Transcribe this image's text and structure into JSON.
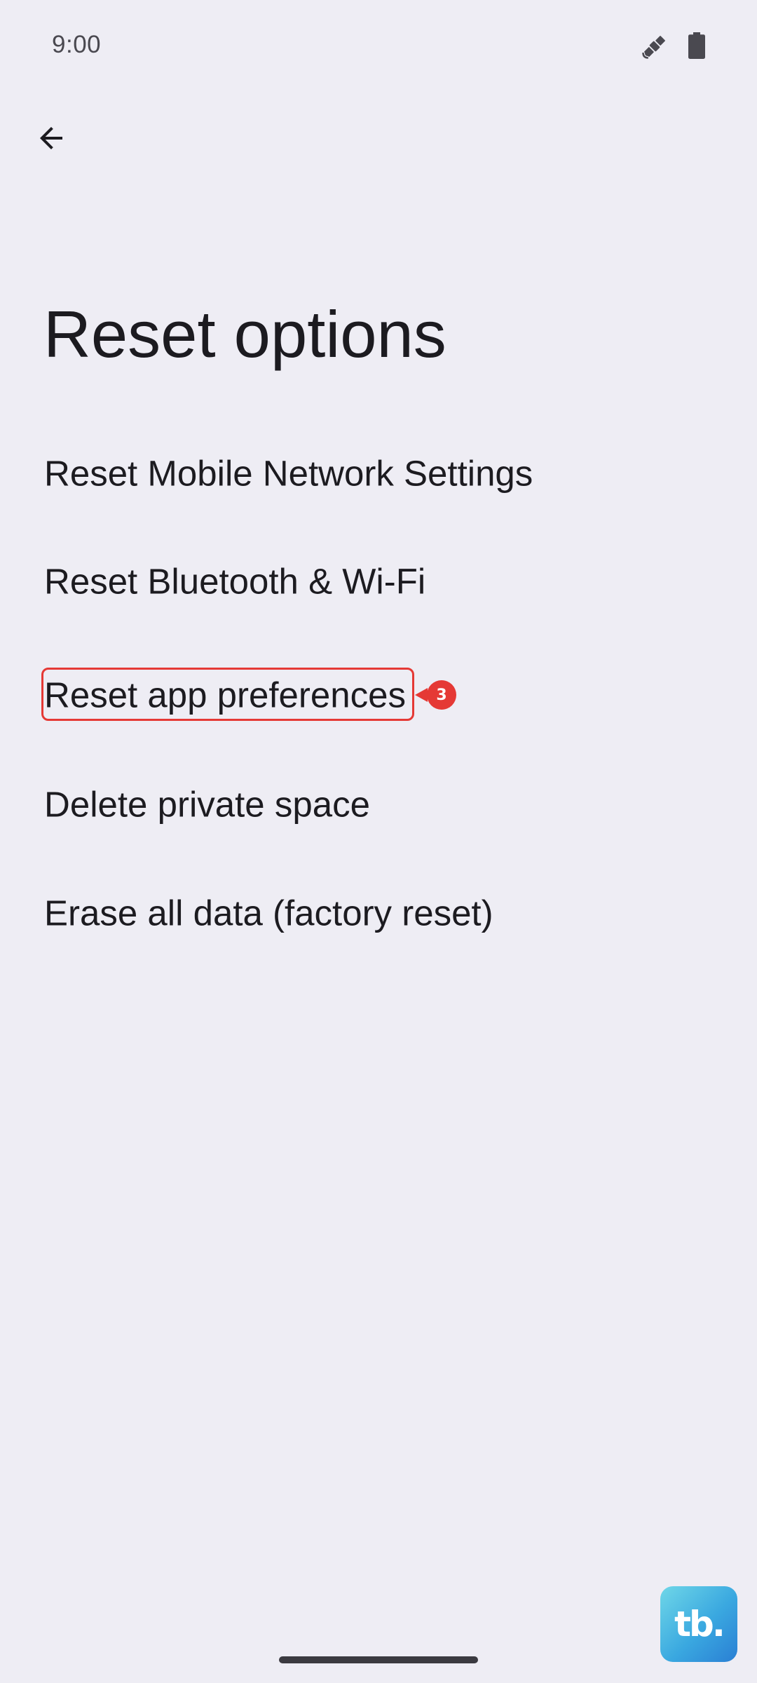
{
  "status_bar": {
    "time": "9:00",
    "icons": [
      "satellite-icon",
      "battery-icon"
    ]
  },
  "toolbar": {
    "back_icon": "arrow-back-icon"
  },
  "page": {
    "title": "Reset options"
  },
  "options": [
    {
      "label": "Reset Mobile Network Settings"
    },
    {
      "label": "Reset Bluetooth & Wi-Fi"
    },
    {
      "label": "Reset app preferences"
    },
    {
      "label": "Delete private space"
    },
    {
      "label": "Erase all data (factory reset)"
    }
  ],
  "annotation": {
    "step_number": "3",
    "color": "#E53935"
  },
  "watermark": {
    "text": "tb."
  },
  "colors": {
    "background": "#EEEDF4",
    "text": "#1C1B20",
    "accent": "#E53935"
  }
}
